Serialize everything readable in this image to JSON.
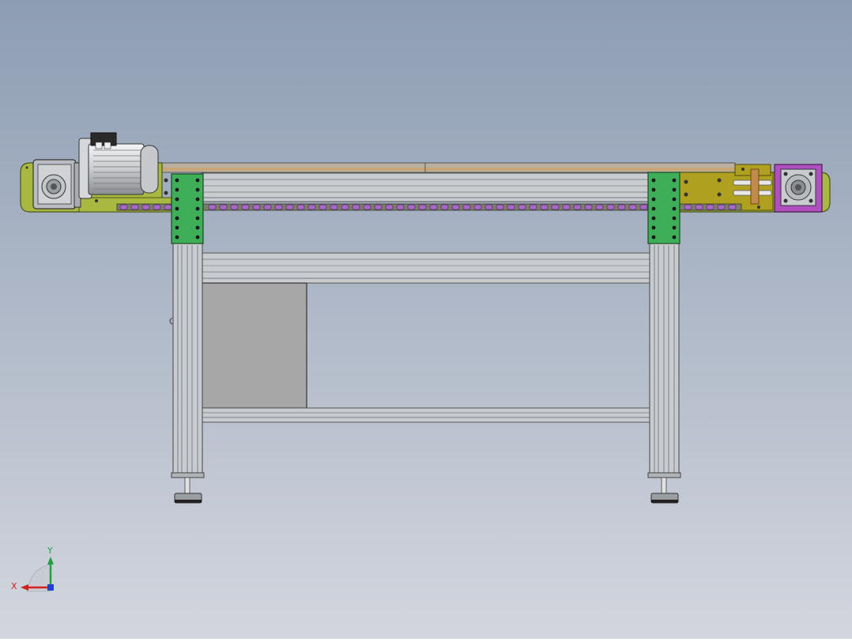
{
  "viewport": {
    "background_top": "#8d9db3",
    "background_bottom": "#d3d6de"
  },
  "colors": {
    "side_plate": "#a8b840",
    "side_plate_dark": "#6f7a24",
    "leg_bracket": "#3fae58",
    "tensioner": "#b0a020",
    "idler_housing": "#b050c0",
    "chain_link": "#a868c8",
    "aluminum": "#c8cbd0",
    "aluminum_dark": "#7c8088",
    "motor_body": "#d8dadc",
    "panel_gray": "#a7a7a7",
    "axis_x": "#d02020",
    "axis_y": "#20a040",
    "axis_z": "#2040d0"
  },
  "parts": {
    "motor_icon": "electric-motor",
    "gearbox_icon": "worm-gear-reducer",
    "idler_icon": "bearing-housing"
  },
  "triad": {
    "x_label": "X",
    "y_label": "Y"
  }
}
